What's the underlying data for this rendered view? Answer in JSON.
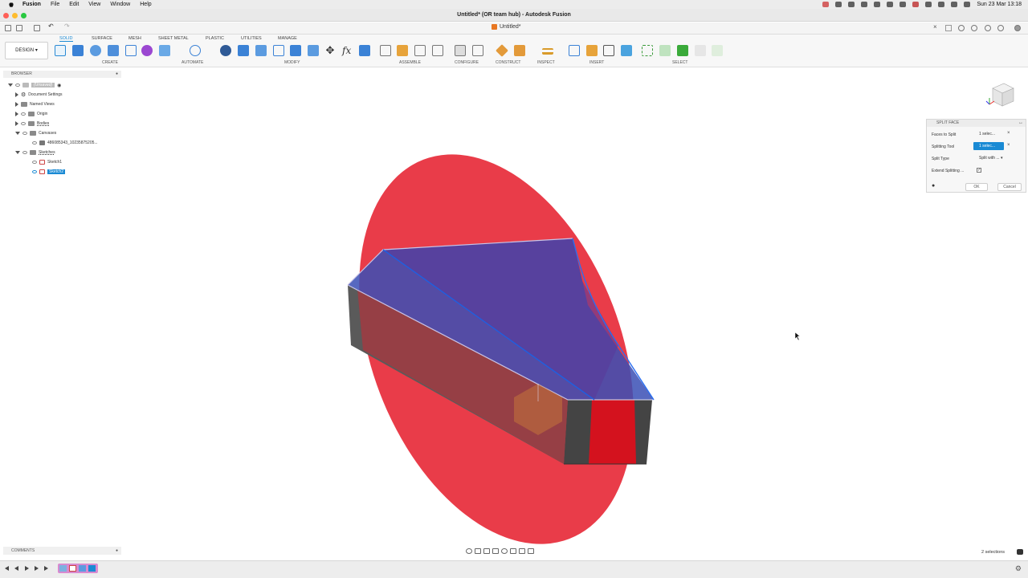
{
  "menubar": {
    "app": "Fusion",
    "items": [
      "File",
      "Edit",
      "View",
      "Window",
      "Help"
    ],
    "clock": "Sun 23 Mar  13:18"
  },
  "window": {
    "title": "Untitled* (OR team hub) - Autodesk Fusion"
  },
  "doc_tab": {
    "label": "Untitled*"
  },
  "toolbar": {
    "workspace": "DESIGN",
    "tabs": [
      "SOLID",
      "SURFACE",
      "MESH",
      "SHEET METAL",
      "PLASTIC",
      "UTILITIES",
      "MANAGE"
    ],
    "active_tab": "SOLID",
    "groups": [
      "CREATE",
      "AUTOMATE",
      "MODIFY",
      "ASSEMBLE",
      "CONFIGURE",
      "CONSTRUCT",
      "INSPECT",
      "INSERT",
      "SELECT"
    ]
  },
  "browser": {
    "title": "BROWSER",
    "root": "(Unsaved)",
    "items": [
      {
        "label": "Document Settings"
      },
      {
        "label": "Named Views"
      },
      {
        "label": "Origin"
      },
      {
        "label": "Bodies"
      },
      {
        "label": "Canvases"
      },
      {
        "label": "486085343_10235875205..."
      },
      {
        "label": "Sketches"
      },
      {
        "label": "Sketch1"
      },
      {
        "label": "Sketch2"
      }
    ]
  },
  "dialog": {
    "title": "SPLIT FACE",
    "rows": [
      {
        "label": "Faces to Split",
        "value": "1 selec..."
      },
      {
        "label": "Splitting Tool",
        "value": "1 selec..."
      },
      {
        "label": "Split Type",
        "value": "Split with ..."
      },
      {
        "label": "Extend Splitting ..."
      }
    ],
    "ok": "OK",
    "cancel": "Cancel"
  },
  "comments": {
    "label": "COMMENTS"
  },
  "status": {
    "selections": "2 selections"
  },
  "colors": {
    "accent": "#1a8ad4",
    "red_face": "#e8323f",
    "blue_face": "#3a4fb5",
    "body": "#5a5a5a"
  }
}
